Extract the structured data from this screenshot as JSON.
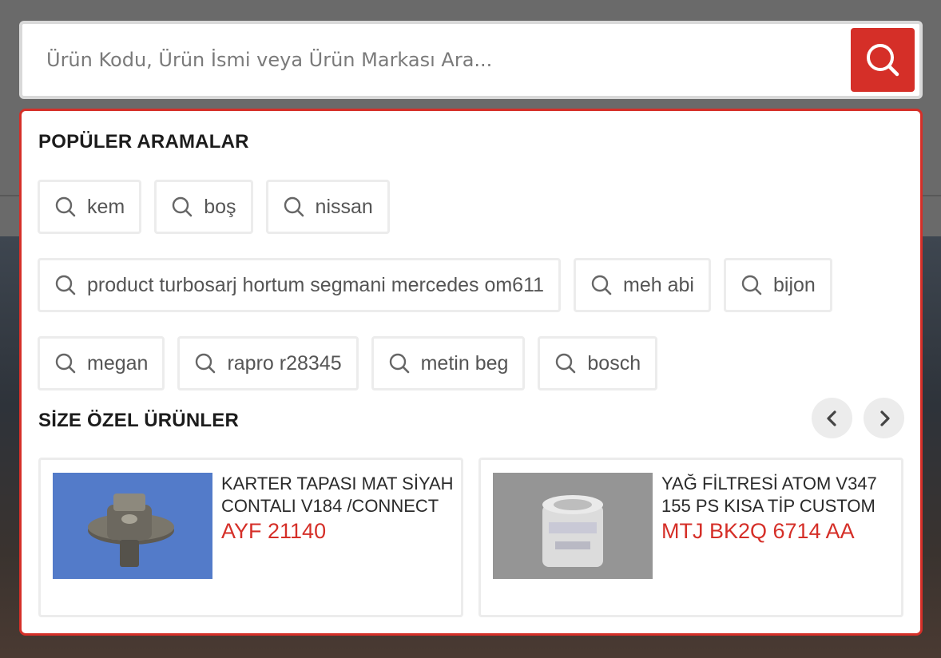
{
  "search": {
    "placeholder": "Ürün Kodu, Ürün İsmi veya Ürün Markası Ara...",
    "value": ""
  },
  "popular": {
    "title": "POPÜLER ARAMALAR",
    "items": [
      "kem",
      "boş",
      "nissan",
      "product turbosarj hortum segmani mercedes om611",
      "meh abi",
      "bijon",
      "megan",
      "rapro r28345",
      "metin beg",
      "bosch"
    ]
  },
  "featured": {
    "title": "SİZE ÖZEL ÜRÜNLER",
    "products": [
      {
        "name": "KARTER TAPASI MAT SİYAH CONTALI V184 /CONNECT",
        "code": "AYF 21140"
      },
      {
        "name": "YAĞ FİLTRESİ ATOM V347 155 PS KISA TİP CUSTOM",
        "code": "MTJ BK2Q 6714 AA"
      }
    ]
  },
  "colors": {
    "accent": "#d52f28",
    "chip_border": "#ececec",
    "text": "#1c1c1c"
  },
  "icons": {
    "search_button": "search-icon",
    "prev": "chevron-left-icon",
    "next": "chevron-right-icon"
  }
}
